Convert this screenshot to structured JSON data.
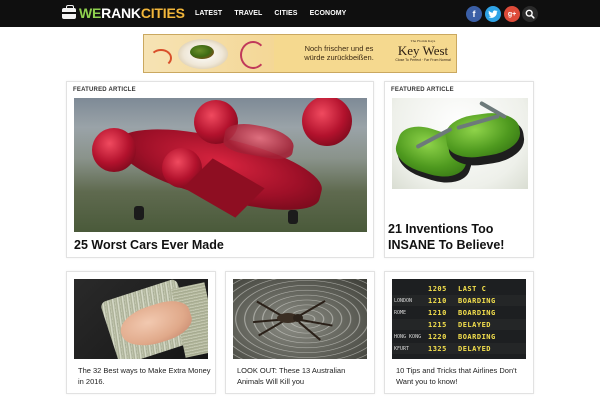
{
  "header": {
    "logo": {
      "we": "WE",
      "rank": "RANK",
      "cities": "CITIES"
    },
    "nav": [
      "LATEST",
      "TRAVEL",
      "CITIES",
      "ECONOMY"
    ],
    "social": {
      "facebook": "f",
      "twitter": "t",
      "googleplus": "g+"
    },
    "search_icon": "search-icon"
  },
  "ad": {
    "text": "Noch frischer und es würde zurückbeißen.",
    "brand_small": "The Florida Keys",
    "brand_big": "Key West",
    "brand_tag": "Close To Perfect · Far From Normal"
  },
  "featured": [
    {
      "label": "FEATURED ARTICLE",
      "title": "25 Worst Cars Ever Made"
    },
    {
      "label": "FEATURED ARTICLE",
      "title": "21 Inventions Too INSANE To Believe!"
    }
  ],
  "articles": [
    {
      "title": "The 32 Best ways to Make Extra Money in 2016."
    },
    {
      "title": "LOOK OUT: These 13 Australian Animals Will Kill you"
    },
    {
      "title": "10 Tips and Tricks that Airlines Don't Want you to know!"
    }
  ],
  "board": [
    {
      "city": "",
      "time": "1205",
      "status": "LAST C"
    },
    {
      "city": "LONDON",
      "time": "1210",
      "status": "BOARDING"
    },
    {
      "city": "ROME",
      "time": "1210",
      "status": "BOARDING"
    },
    {
      "city": "",
      "time": "1215",
      "status": "DELAYED"
    },
    {
      "city": "HONG KONG",
      "time": "1220",
      "status": "BOARDING"
    },
    {
      "city": "KFURT",
      "time": "1325",
      "status": "DELAYED"
    }
  ]
}
